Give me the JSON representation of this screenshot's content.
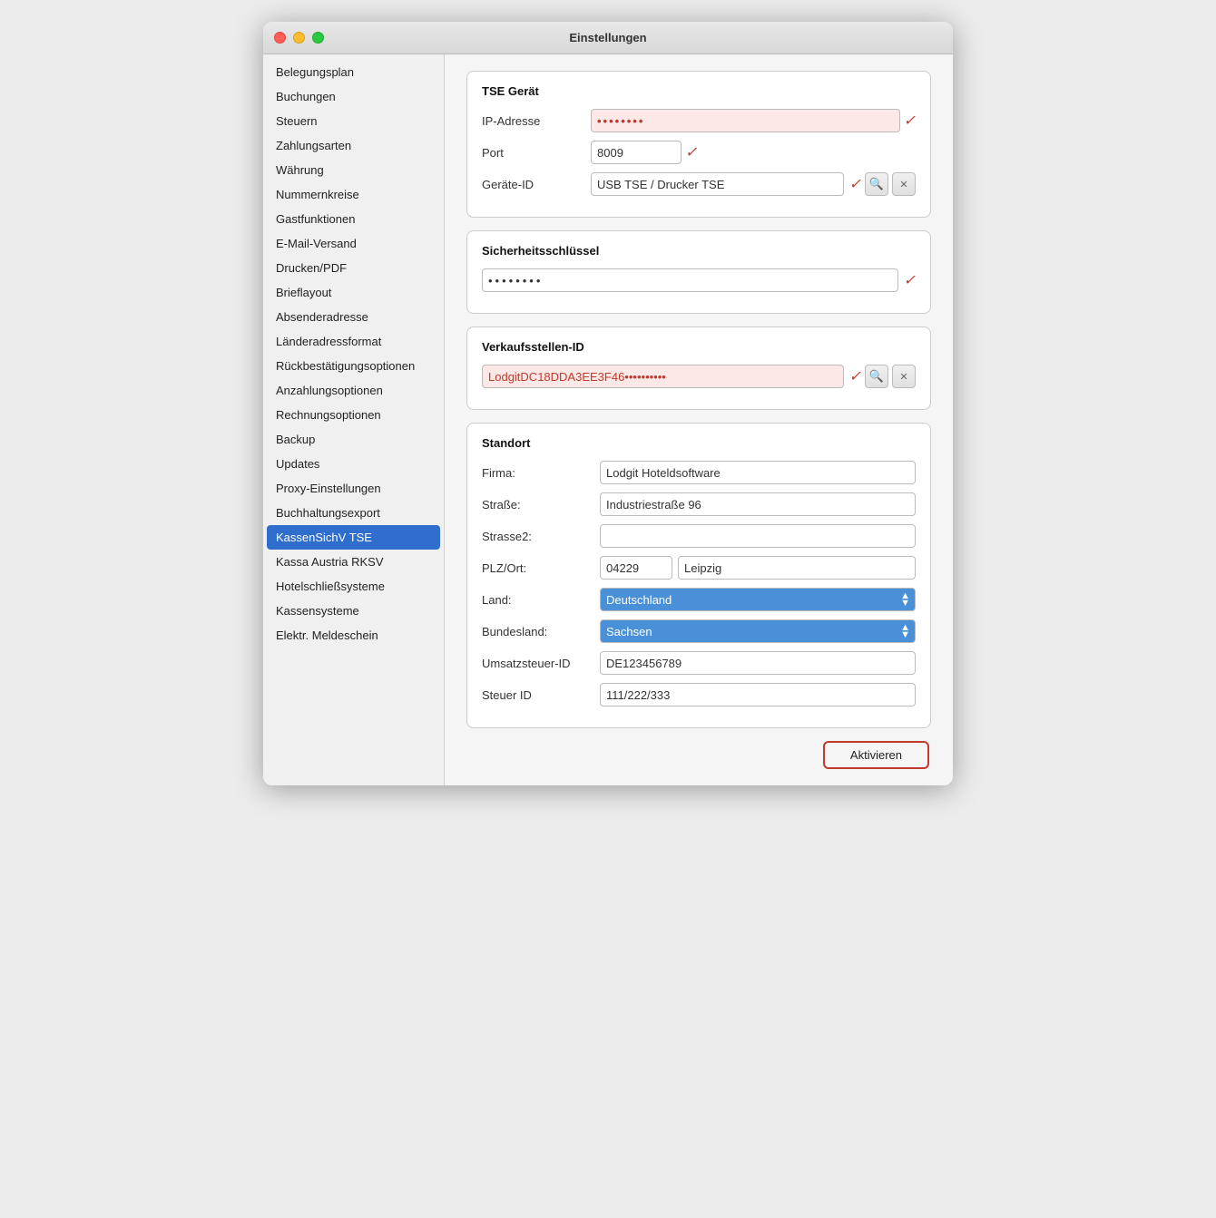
{
  "window": {
    "title": "Einstellungen"
  },
  "sidebar": {
    "items": [
      {
        "label": "Belegungsplan",
        "active": false
      },
      {
        "label": "Buchungen",
        "active": false
      },
      {
        "label": "Steuern",
        "active": false
      },
      {
        "label": "Zahlungsarten",
        "active": false
      },
      {
        "label": "Währung",
        "active": false
      },
      {
        "label": "Nummernkreise",
        "active": false
      },
      {
        "label": "Gastfunktionen",
        "active": false
      },
      {
        "label": "E-Mail-Versand",
        "active": false
      },
      {
        "label": "Drucken/PDF",
        "active": false
      },
      {
        "label": "Brieflayout",
        "active": false
      },
      {
        "label": "Absenderadresse",
        "active": false
      },
      {
        "label": "Länderadressformat",
        "active": false
      },
      {
        "label": "Rückbestätigungsoptionen",
        "active": false
      },
      {
        "label": "Anzahlungsoptionen",
        "active": false
      },
      {
        "label": "Rechnungsoptionen",
        "active": false
      },
      {
        "label": "Backup",
        "active": false
      },
      {
        "label": "Updates",
        "active": false
      },
      {
        "label": "Proxy-Einstellungen",
        "active": false
      },
      {
        "label": "Buchhaltungsexport",
        "active": false
      },
      {
        "label": "KassenSichV TSE",
        "active": true
      },
      {
        "label": "Kassa Austria RKSV",
        "active": false
      },
      {
        "label": "Hotelschließsysteme",
        "active": false
      },
      {
        "label": "Kassensysteme",
        "active": false
      },
      {
        "label": "Elektr. Meldeschein",
        "active": false
      }
    ]
  },
  "tse_geraet": {
    "section_title": "TSE Gerät",
    "ip_label": "IP-Adresse",
    "ip_value": "••••••••",
    "port_label": "Port",
    "port_value": "8009",
    "geraete_id_label": "Geräte-ID",
    "geraete_id_value": "USB TSE / Drucker TSE"
  },
  "sicherheitsschluessel": {
    "section_title": "Sicherheitsschlüssel",
    "password_value": "••••••••"
  },
  "verkaufsstellen_id": {
    "section_title": "Verkaufsstellen-ID",
    "id_value": "LodgitDC18DDA3EE3F46••••••••••"
  },
  "standort": {
    "section_title": "Standort",
    "firma_label": "Firma:",
    "firma_value": "Lodgit Hoteldsoftware",
    "strasse_label": "Straße:",
    "strasse_value": "Industriestraße 96",
    "strasse2_label": "Strasse2:",
    "strasse2_value": "",
    "plz_ort_label": "PLZ/Ort:",
    "plz_value": "04229",
    "ort_value": "Leipzig",
    "land_label": "Land:",
    "land_value": "Deutschland",
    "bundesland_label": "Bundesland:",
    "bundesland_value": "Sachsen",
    "ust_id_label": "Umsatzsteuer-ID",
    "ust_id_value": "DE123456789",
    "steuer_id_label": "Steuer ID",
    "steuer_id_value": "111/222/333"
  },
  "buttons": {
    "aktivieren": "Aktivieren",
    "search_icon": "🔍",
    "clear_icon": "✕",
    "arrow_up": "▲",
    "arrow_down": "▼"
  }
}
